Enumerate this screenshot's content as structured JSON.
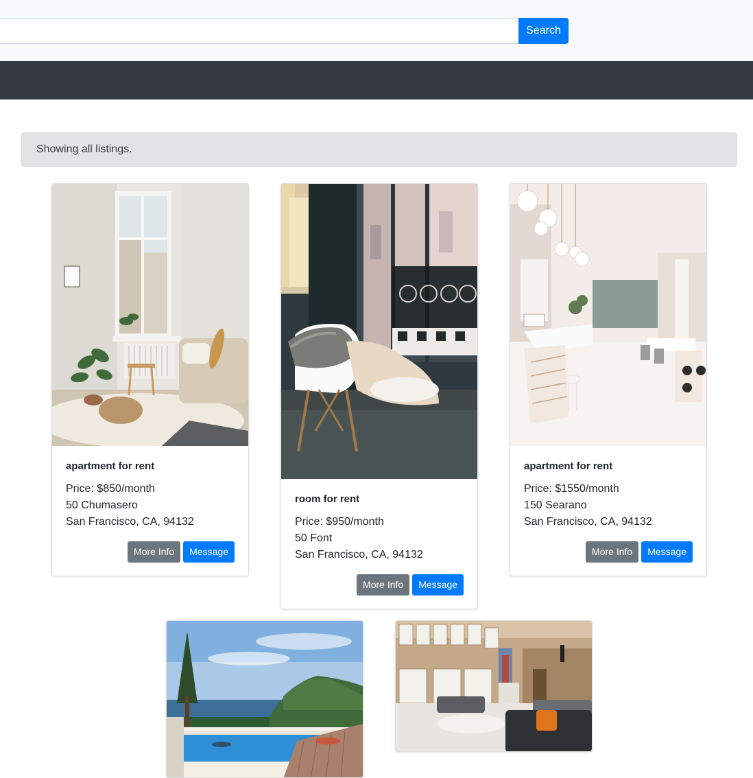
{
  "search": {
    "placeholder": "",
    "value": "",
    "button_label": "Search"
  },
  "alert": {
    "text": "Showing all listings."
  },
  "listings": [
    {
      "title": "apartment for rent",
      "price": "Price: $850/month",
      "address": "50 Chumasero",
      "city": "San Francisco, CA, 94132",
      "more_info": "More Info",
      "message": "Message"
    },
    {
      "title": "room for rent",
      "price": "Price: $950/month",
      "address": "50 Font",
      "city": "San Francisco, CA, 94132",
      "more_info": "More Info",
      "message": "Message"
    },
    {
      "title": "apartment for rent",
      "price": "Price: $1550/month",
      "address": "150 Searano",
      "city": "San Francisco, CA, 94132",
      "more_info": "More Info",
      "message": "Message"
    }
  ],
  "colors": {
    "primary": "#007bff",
    "secondary": "#6c757d",
    "navbar": "#343a40",
    "alert_bg": "#e2e3e5"
  }
}
